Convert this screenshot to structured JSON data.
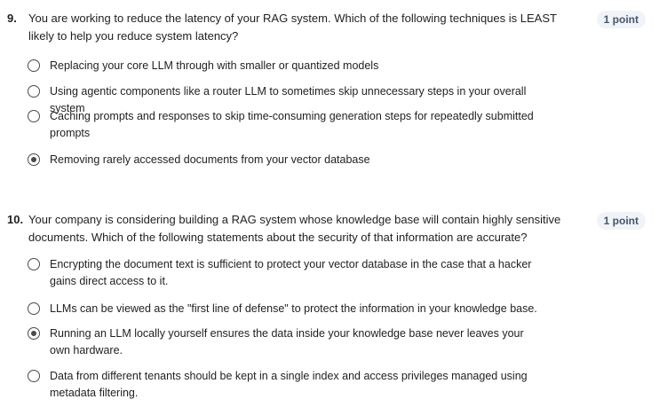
{
  "questions": [
    {
      "number": "9.",
      "text": "You are working to reduce the latency of your RAG system. Which of the following techniques is LEAST likely to help you reduce system latency?",
      "points": "1 point",
      "options": [
        {
          "label": "Replacing your core LLM through with smaller or quantized models",
          "selected": false
        },
        {
          "label": "Using agentic components like a router LLM to sometimes skip unnecessary steps in your overall system",
          "selected": false
        },
        {
          "label": "Caching prompts and responses to skip time-consuming generation steps for repeatedly submitted prompts",
          "selected": false
        },
        {
          "label": "Removing rarely accessed documents from your vector database",
          "selected": true
        }
      ]
    },
    {
      "number": "10.",
      "text": "Your company is considering building a RAG system whose knowledge base will contain highly sensitive documents. Which of the following statements about the security of that information are accurate?",
      "points": "1 point",
      "options": [
        {
          "label": "Encrypting the document text is sufficient to protect your vector database in the case that a hacker gains direct access to it.",
          "selected": false
        },
        {
          "label": "LLMs can be viewed as the \"first line of defense\" to protect the information in your knowledge base.",
          "selected": false
        },
        {
          "label": "Running an LLM locally yourself ensures the data inside your knowledge base never leaves your own hardware.",
          "selected": true
        },
        {
          "label": "Data from different tenants should be kept in a single index and access privileges managed using metadata filtering.",
          "selected": false
        }
      ]
    }
  ]
}
